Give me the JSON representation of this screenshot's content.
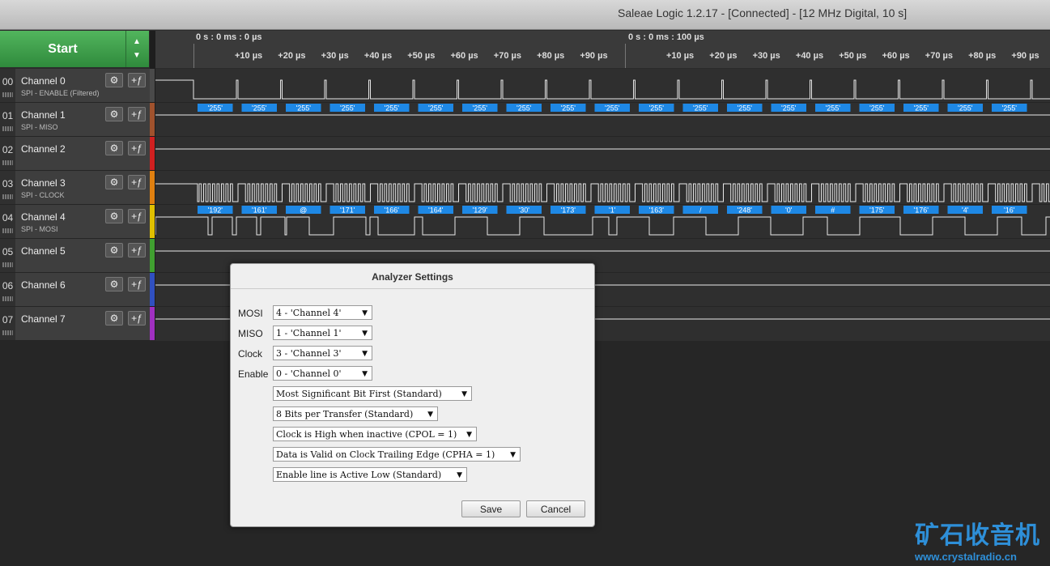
{
  "window": {
    "title": "Saleae Logic 1.2.17 - [Connected] - [12 MHz Digital, 10 s]"
  },
  "toolbar": {
    "start_label": "Start"
  },
  "timeline": {
    "ref_left": "0 s : 0 ms : 0 µs",
    "ref_right": "0 s : 0 ms : 100 µs",
    "ticks_left": [
      "+10 µs",
      "+20 µs",
      "+30 µs",
      "+40 µs",
      "+50 µs",
      "+60 µs",
      "+70 µs",
      "+80 µs",
      "+90 µs"
    ],
    "ticks_right": [
      "+10 µs",
      "+20 µs",
      "+30 µs",
      "+40 µs",
      "+50 µs",
      "+60 µs",
      "+70 µs",
      "+80 µs",
      "+90 µs"
    ]
  },
  "channels": [
    {
      "num": "00",
      "name": "Channel 0",
      "sub": "SPI - ENABLE (Filtered)",
      "color": "#4a4a4a"
    },
    {
      "num": "01",
      "name": "Channel 1",
      "sub": "SPI - MISO",
      "color": "#a0522d"
    },
    {
      "num": "02",
      "name": "Channel 2",
      "sub": "",
      "color": "#d02020"
    },
    {
      "num": "03",
      "name": "Channel 3",
      "sub": "SPI - CLOCK",
      "color": "#e08010"
    },
    {
      "num": "04",
      "name": "Channel 4",
      "sub": "SPI - MOSI",
      "color": "#e0c000"
    },
    {
      "num": "05",
      "name": "Channel 5",
      "sub": "",
      "color": "#40a030"
    },
    {
      "num": "06",
      "name": "Channel 6",
      "sub": "",
      "color": "#3050c0"
    },
    {
      "num": "07",
      "name": "Channel 7",
      "sub": "",
      "color": "#a030c0"
    }
  ],
  "decoded": {
    "miso": [
      "'255'",
      "'255'",
      "'255'",
      "'255'",
      "'255'",
      "'255'",
      "'255'",
      "'255'",
      "'255'",
      "'255'",
      "'255'",
      "'255'",
      "'255'",
      "'255'",
      "'255'",
      "'255'",
      "'255'",
      "'255'",
      "'255'"
    ],
    "mosi": [
      "'192'",
      "'161'",
      "@",
      "'171'",
      "'166'",
      "'164'",
      "'129'",
      "'30'",
      "'173'",
      "'1'",
      "'163'",
      "/",
      "'248'",
      "'0'",
      "#",
      "'175'",
      "'176'",
      "'4'",
      "'16'"
    ],
    "label_color": "#1e88e5"
  },
  "dialog": {
    "title": "Analyzer Settings",
    "mosi_label": "MOSI",
    "mosi_value": "4 - 'Channel 4'",
    "miso_label": "MISO",
    "miso_value": "1 - 'Channel 1'",
    "clock_label": "Clock",
    "clock_value": "3 - 'Channel 3'",
    "enable_label": "Enable",
    "enable_value": "0 - 'Channel 0'",
    "bit_order": "Most Significant Bit First (Standard)",
    "bits": "8 Bits per Transfer (Standard)",
    "cpol": "Clock is High when inactive (CPOL = 1)",
    "cpha": "Data is Valid on Clock Trailing Edge (CPHA = 1)",
    "enable_active": "Enable line is Active Low (Standard)",
    "save_label": "Save",
    "cancel_label": "Cancel"
  },
  "watermark": {
    "big": "矿石收音机",
    "url": "www.crystalradio.cn"
  }
}
